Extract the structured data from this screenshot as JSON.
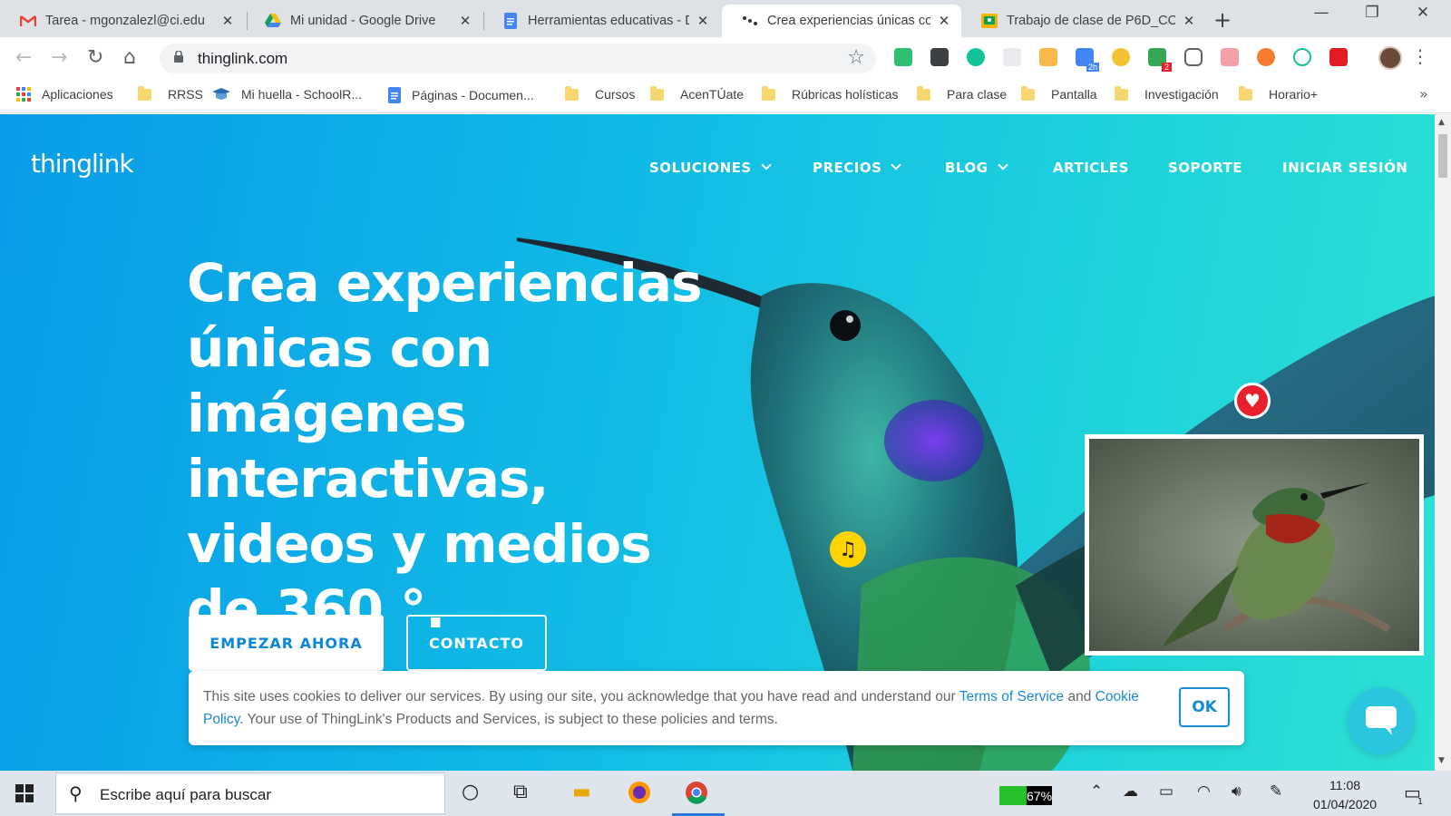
{
  "browser": {
    "tabs": [
      {
        "title": "Tarea - mgonzalezl@ci.edu",
        "icon": "gmail-icon"
      },
      {
        "title": "Mi unidad - Google Drive",
        "icon": "google-drive-icon"
      },
      {
        "title": "Herramientas educativas - D",
        "icon": "google-docs-icon"
      },
      {
        "title": "Crea experiencias únicas co",
        "icon": "thinglink-icon",
        "active": true
      },
      {
        "title": "Trabajo de clase de P6D_CC",
        "icon": "google-classroom-icon"
      }
    ],
    "address": {
      "url": "thinglink.com"
    },
    "bookmarks": [
      {
        "label": "Aplicaciones",
        "icon": "apps-grid-icon"
      },
      {
        "label": "RRSS",
        "icon": "folder-icon"
      },
      {
        "label": "Mi huella - SchoolR...",
        "icon": "schoolr-icon"
      },
      {
        "label": "Páginas - Documen...",
        "icon": "google-docs-icon"
      },
      {
        "label": "Cursos",
        "icon": "folder-icon"
      },
      {
        "label": "AcenTÚate",
        "icon": "folder-icon"
      },
      {
        "label": "Rúbricas holísticas",
        "icon": "folder-icon"
      },
      {
        "label": "Para clase",
        "icon": "folder-icon"
      },
      {
        "label": "Pantalla",
        "icon": "folder-icon"
      },
      {
        "label": "Investigación",
        "icon": "folder-icon"
      },
      {
        "label": "Horario+",
        "icon": "folder-icon"
      }
    ],
    "extension_badges": {
      "calendar": "2h",
      "shield": "2"
    }
  },
  "site": {
    "logo": "thinglink",
    "nav": [
      {
        "label": "SOLUCIONES",
        "dropdown": true
      },
      {
        "label": "PRECIOS",
        "dropdown": true
      },
      {
        "label": "BLOG",
        "dropdown": true
      },
      {
        "label": "ARTICLES",
        "dropdown": false
      },
      {
        "label": "SOPORTE",
        "dropdown": false
      },
      {
        "label": "INICIAR SESIÓN",
        "dropdown": false
      }
    ],
    "hero": {
      "title": "Crea experiencias únicas con imágenes interactivas, videos y medios de 360 °.",
      "primary_button": "EMPEZAR AHORA",
      "secondary_button": "CONTACTO"
    },
    "cookie": {
      "text_1": "This site uses cookies to deliver our services. By using our site, you acknowledge that you have read and understand our ",
      "link_terms": "Terms of Service",
      "text_2": " and ",
      "link_cookie": "Cookie Policy",
      "text_3": ". Your use of ThingLink's Products and Services, is subject to these policies and terms.",
      "ok": "OK"
    },
    "tags": [
      "heart-icon",
      "music-note-icon"
    ],
    "colors": {
      "gradient_start": "#0a9be8",
      "gradient_end": "#2de0d3",
      "link": "#1a8ad8",
      "heart_tag": "#e8202e",
      "music_tag": "#ffd400"
    }
  },
  "taskbar": {
    "search_placeholder": "Escribe aquí para buscar",
    "battery": "67%",
    "time": "11:08",
    "date": "01/04/2020",
    "notifications": "1"
  }
}
